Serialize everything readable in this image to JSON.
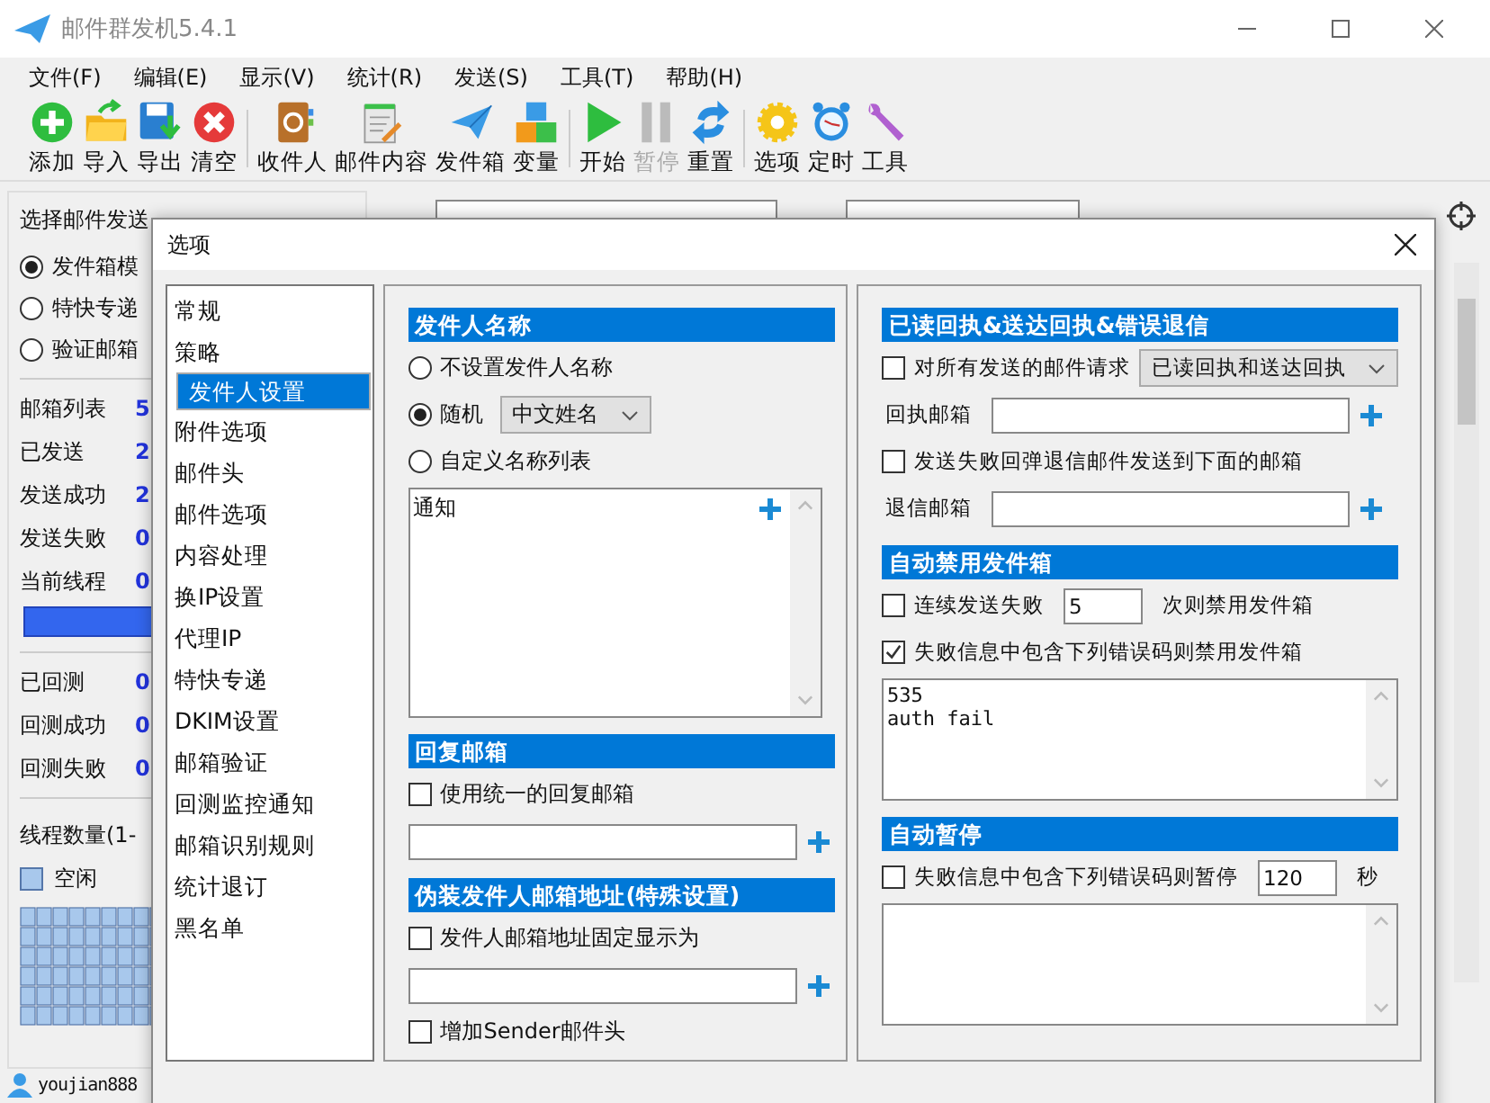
{
  "window": {
    "title": "邮件群发机5.4.1"
  },
  "menu": [
    "文件(F)",
    "编辑(E)",
    "显示(V)",
    "统计(R)",
    "发送(S)",
    "工具(T)",
    "帮助(H)"
  ],
  "toolbar_groups": [
    [
      {
        "label": "添加",
        "kind": "add",
        "disabled": false
      },
      {
        "label": "导入",
        "kind": "import",
        "disabled": false
      },
      {
        "label": "导出",
        "kind": "export",
        "disabled": false
      },
      {
        "label": "清空",
        "kind": "clear",
        "disabled": false
      }
    ],
    [
      {
        "label": "收件人",
        "kind": "contacts",
        "disabled": false
      },
      {
        "label": "邮件内容",
        "kind": "content",
        "disabled": false
      },
      {
        "label": "发件箱",
        "kind": "outbox",
        "disabled": false
      },
      {
        "label": "变量",
        "kind": "blocks",
        "disabled": false
      }
    ],
    [
      {
        "label": "开始",
        "kind": "start",
        "disabled": false
      },
      {
        "label": "暂停",
        "kind": "pause",
        "disabled": true
      },
      {
        "label": "重置",
        "kind": "reset",
        "disabled": false
      }
    ],
    [
      {
        "label": "选项",
        "kind": "gear",
        "disabled": false
      },
      {
        "label": "定时",
        "kind": "clock",
        "disabled": false
      },
      {
        "label": "工具",
        "kind": "wrench",
        "disabled": false
      }
    ]
  ],
  "left_panel": {
    "title": "选择邮件发送",
    "modes": [
      {
        "label": "发件箱模",
        "selected": true
      },
      {
        "label": "特快专递",
        "selected": false
      },
      {
        "label": "验证邮箱",
        "selected": false
      }
    ],
    "send_stats": [
      {
        "label": "邮箱列表",
        "value": "5"
      },
      {
        "label": "已发送",
        "value": "2"
      },
      {
        "label": "发送成功",
        "value": "2"
      },
      {
        "label": "发送失败",
        "value": "0"
      },
      {
        "label": "当前线程",
        "value": "0"
      }
    ],
    "check_stats": [
      {
        "label": "已回测",
        "value": "0"
      },
      {
        "label": "回测成功",
        "value": "0"
      },
      {
        "label": "回测失败",
        "value": "0"
      }
    ],
    "progress": {
      "level": 1
    },
    "threads_label": "线程数量(1-",
    "legend": "空闲"
  },
  "status_bar": {
    "user": "youjian888"
  },
  "dialog": {
    "title": "选项",
    "nav": [
      {
        "label": "常规",
        "selected": false
      },
      {
        "label": "策略",
        "selected": false
      },
      {
        "label": "发件人设置",
        "selected": true
      },
      {
        "label": "附件选项",
        "selected": false
      },
      {
        "label": "邮件头",
        "selected": false
      },
      {
        "label": "邮件选项",
        "selected": false
      },
      {
        "label": "内容处理",
        "selected": false
      },
      {
        "label": "换IP设置",
        "selected": false
      },
      {
        "label": "代理IP",
        "selected": false
      },
      {
        "label": "特快专递",
        "selected": false
      },
      {
        "label": "DKIM设置",
        "selected": false
      },
      {
        "label": "邮箱验证",
        "selected": false
      },
      {
        "label": "回测监控通知",
        "selected": false
      },
      {
        "label": "邮箱识别规则",
        "selected": false
      },
      {
        "label": "统计退订",
        "selected": false
      },
      {
        "label": "黑名单",
        "selected": false
      }
    ],
    "sender_name": {
      "title": "发件人名称",
      "options": [
        {
          "label": "不设置发件人名称",
          "selected": false
        },
        {
          "label": "随机",
          "selected": true,
          "select_value": "中文姓名"
        },
        {
          "label": "自定义名称列表",
          "selected": false
        }
      ],
      "list_text": "通知"
    },
    "reply": {
      "title": "回复邮箱",
      "checkbox": {
        "label": "使用统一的回复邮箱",
        "checked": false
      }
    },
    "spoof": {
      "title": "伪装发件人邮箱地址(特殊设置)",
      "checkbox": {
        "label": "发件人邮箱地址固定显示为",
        "checked": false
      },
      "sender_header": {
        "label": "增加Sender邮件头",
        "checked": false
      }
    },
    "receipt": {
      "title": "已读回执&送达回执&错误退信",
      "request": {
        "label": "对所有发送的邮件请求",
        "checked": false,
        "select_value": "已读回执和送达回执"
      },
      "receipt_label": "回执邮箱",
      "bounce": {
        "label": "发送失败回弹退信邮件发送到下面的邮箱",
        "checked": false
      },
      "bounce_label": "退信邮箱"
    },
    "auto_disable": {
      "title": "自动禁用发件箱",
      "consecutive": {
        "label": "连续发送失败",
        "checked": false,
        "value": "5",
        "suffix": "次则禁用发件箱"
      },
      "codes": {
        "label": "失败信息中包含下列错误码则禁用发件箱",
        "checked": true,
        "lines": [
          "535",
          "auth fail"
        ]
      }
    },
    "auto_pause": {
      "title": "自动暂停",
      "codes": {
        "label": "失败信息中包含下列错误码则暂停",
        "checked": false,
        "value": "120",
        "suffix": "秒"
      }
    }
  }
}
